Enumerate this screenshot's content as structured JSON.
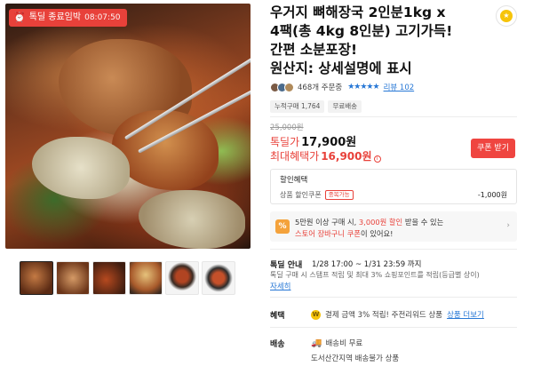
{
  "gallery": {
    "deal_badge_label": "톡딜 종료임박",
    "deal_badge_timer": "08:07:50",
    "thumbnail_count": 6
  },
  "product": {
    "title_line1": "우거지 뼈해장국 2인분1kg x",
    "title_line2": "4팩(총 4kg 8인분) 고기가득!",
    "title_line3": "간편 소분포장!",
    "title_line4": "원산지: 상세설명에 표시"
  },
  "reviews": {
    "orders": "468개 주문중",
    "stars": "★★★★★",
    "review_link": "리뷰 102"
  },
  "chips": [
    "누적구매 1,764",
    "무료배송"
  ],
  "price": {
    "original": "25,000원",
    "deal_label": "톡딜가",
    "deal_price": "17,900원",
    "max_label": "최대혜택가",
    "max_price": "16,900원",
    "info_icon": "i",
    "coupon_button": "쿠폰 받기"
  },
  "discount": {
    "title": "할인혜택",
    "item_label": "상품 할인쿠폰",
    "item_tag": "중복가능",
    "item_amount": "-1,000원"
  },
  "promo": {
    "icon_text": "%",
    "line1_pre": "5만원 이상 구매 시, ",
    "line1_hl": "3,000원 할인",
    "line1_post": " 받을 수 있는",
    "line2_hl": "스토어 장바구니 쿠폰",
    "line2_post": "이 있어요!",
    "arrow": "›"
  },
  "deal_info": {
    "label": "톡딜 안내",
    "period": "1/28 17:00 ~ 1/31 23:59 까지",
    "desc": "톡딜 구매 시 스탬프 적립 및 최대 3% 쇼핑포인트를 적립(등급별 상이)",
    "more": "자세히"
  },
  "benefit": {
    "label": "혜택",
    "coin": "W",
    "text": "결제 금액 3% 적립! 주전리워드 상품",
    "link": "상품 더보기"
  },
  "shipping": {
    "label": "배송",
    "fee": "배송비 무료",
    "sub": "도서산간지역 배송불가 상품"
  },
  "icons": {
    "favorite": "coin-favorite-icon",
    "clock": "clock-icon",
    "truck": "truck-icon"
  },
  "colors": {
    "accent_red": "#e8413a",
    "link_blue": "#2878d6",
    "promo_orange": "#f4a23b"
  }
}
